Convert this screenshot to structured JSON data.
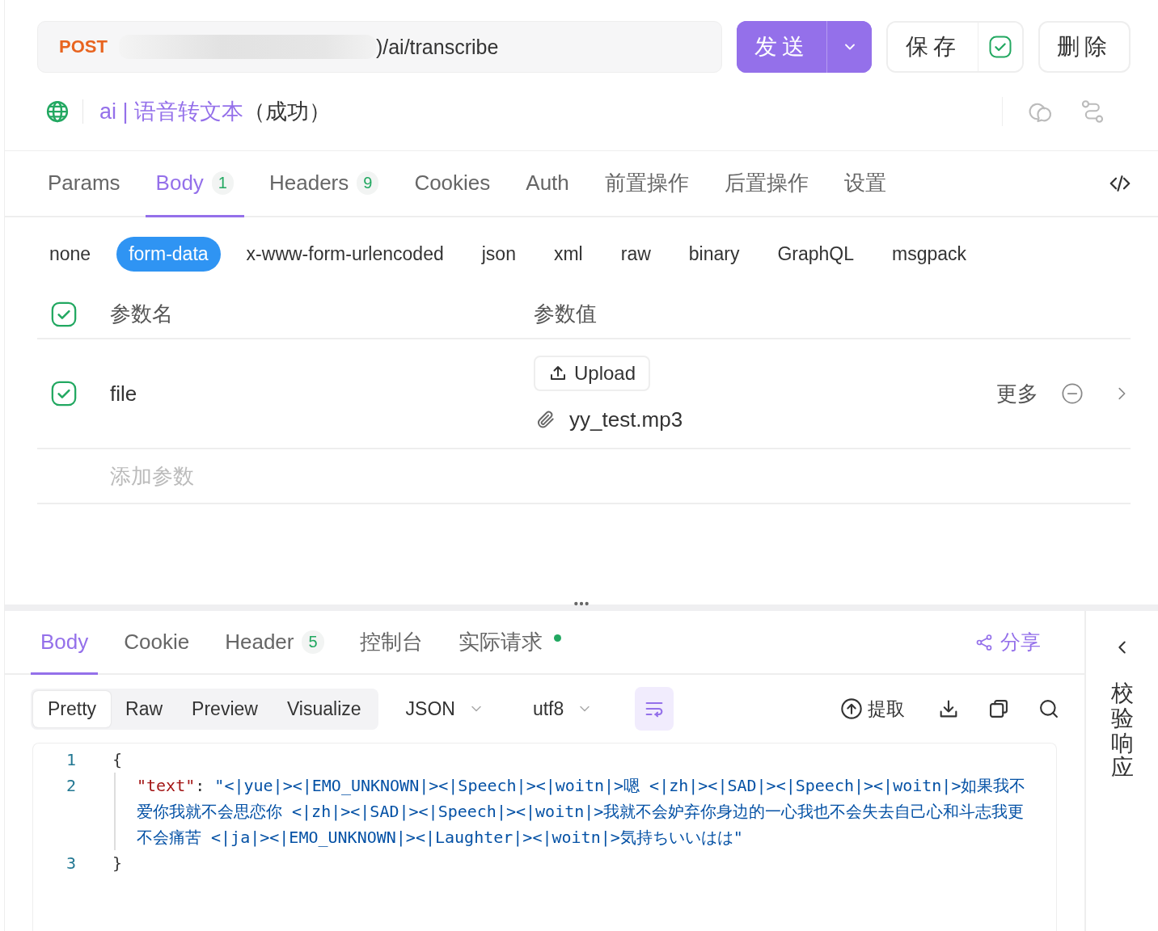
{
  "request_bar": {
    "method": "POST",
    "url": ")/ai/transcribe",
    "buttons": [
      {
        "kind": "send",
        "label": "发送"
      },
      {
        "kind": "save",
        "label": "保存",
        "auto_save_checked": true
      },
      {
        "kind": "delete",
        "label": "删除"
      }
    ]
  },
  "request_info": {
    "name": "ai | 语音转文本",
    "status": "（成功）"
  },
  "request_tabs": [
    {
      "label": "Params",
      "selected": false
    },
    {
      "label": "Body",
      "count": "1",
      "selected": true
    },
    {
      "label": "Headers",
      "count": "9",
      "selected": false
    },
    {
      "label": "Cookies",
      "selected": false
    },
    {
      "label": "Auth",
      "selected": false
    },
    {
      "label": "前置操作",
      "selected": false
    },
    {
      "label": "后置操作",
      "selected": false
    },
    {
      "label": "设置",
      "selected": false
    }
  ],
  "body_types": [
    {
      "label": "none",
      "selected": false
    },
    {
      "label": "form-data",
      "selected": true
    },
    {
      "label": "x-www-form-urlencoded",
      "selected": false
    },
    {
      "label": "json",
      "selected": false
    },
    {
      "label": "xml",
      "selected": false
    },
    {
      "label": "raw",
      "selected": false
    },
    {
      "label": "binary",
      "selected": false
    },
    {
      "label": "GraphQL",
      "selected": false
    },
    {
      "label": "msgpack",
      "selected": false
    }
  ],
  "params_table": {
    "all_checked": true,
    "columns": [
      "参数名",
      "参数值"
    ],
    "rows": [
      {
        "checked": true,
        "name": "file",
        "upload_label": "Upload",
        "file_name": "yy_test.mp3",
        "more": "更多"
      }
    ],
    "add_placeholder": "添加参数"
  },
  "response_tabs": [
    {
      "label": "Body",
      "selected": true
    },
    {
      "label": "Cookie",
      "selected": false
    },
    {
      "label": "Header",
      "count": "5",
      "selected": false
    },
    {
      "label": "控制台",
      "selected": false
    },
    {
      "label": "实际请求",
      "color": "#22a861",
      "selected": false
    }
  ],
  "share_label": "分享",
  "view_modes": [
    {
      "label": "Pretty",
      "selected": true
    },
    {
      "label": "Raw",
      "selected": false
    },
    {
      "label": "Preview",
      "selected": false
    },
    {
      "label": "Visualize",
      "selected": false
    }
  ],
  "format": "JSON",
  "encoding": "utf8",
  "wrap_on": true,
  "extract_label": "提取",
  "code": [
    {
      "number": "1",
      "tokens": [
        {
          "kind": "punct",
          "text": "{"
        }
      ]
    },
    {
      "number": "2",
      "tokens": [
        {
          "kind": "key",
          "text": "\"text\""
        },
        {
          "kind": "punct",
          "text": ": "
        },
        {
          "kind": "string",
          "text": "\"<|yue|><|EMO_UNKNOWN|><|Speech|><|woitn|>嗯 <|zh|><|SAD|><|Speech|><|woitn|>如果我不爱你我就不会思恋你 <|zh|><|SAD|><|Speech|><|woitn|>我就不会妒弃你身边的一心我也不会失去自己心和斗志我更不会痛苦 <|ja|><|EMO_UNKNOWN|><|Laughter|><|woitn|>気持ちいいはは\""
        }
      ]
    },
    {
      "number": "3",
      "tokens": [
        {
          "kind": "punct",
          "text": "}"
        }
      ]
    }
  ],
  "side_panel": {
    "title": "校验响应"
  }
}
